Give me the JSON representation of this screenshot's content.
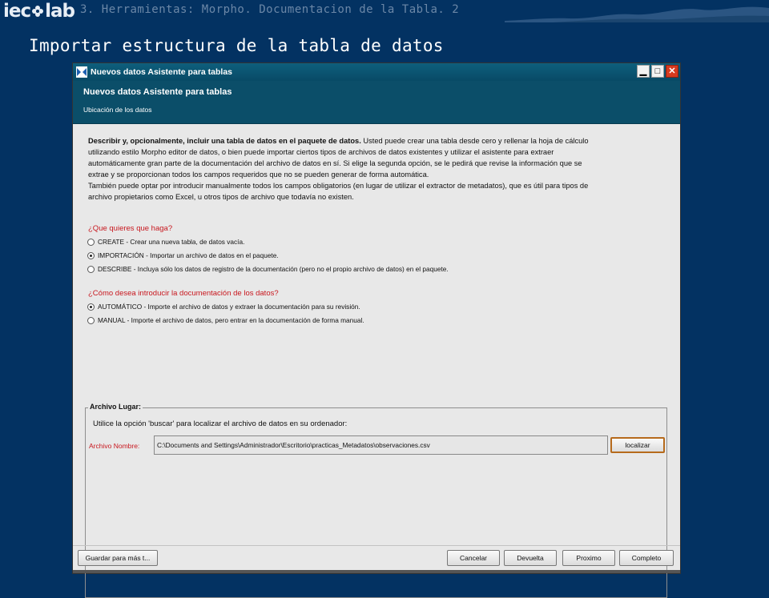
{
  "slide": {
    "logo_text_left": "iec",
    "logo_text_right": "lab",
    "breadcrumb": "3. Herramientas: Morpho. Documentacion de la Tabla. 2",
    "title": "Importar estructura de la tabla de datos"
  },
  "window": {
    "title": "Nuevos datos Asistente para tablas",
    "header_title": "Nuevos datos Asistente para tablas",
    "header_subtitle": "Ubicación de los datos",
    "minimize_glyph": "▁",
    "maximize_glyph": "□",
    "close_glyph": "✕"
  },
  "intro": {
    "bold": "Describir y, opcionalmente, incluir una tabla de datos en el paquete de datos.",
    "text1": " Usted puede crear una tabla desde cero y rellenar la hoja de cálculo utilizando estilo Morpho editor de datos, o bien puede importar ciertos tipos de archivos de datos existentes y utilizar el asistente para extraer automáticamente gran parte de la documentación del archivo de datos en sí. Si elige la segunda opción, se le pedirá que revise la información que se extrae y se proporcionan todos los campos requeridos que no se pueden generar de forma automática.",
    "text2": "También puede optar por introducir manualmente todos los campos obligatorios (en lugar de utilizar el extractor de metadatos), que es útil para tipos de archivo propietarios como Excel, u otros tipos de archivo que todavía no existen."
  },
  "question1": {
    "label": "¿Que quieres que haga?",
    "options": [
      {
        "text": "CREATE - Crear una nueva tabla, de datos vacía.",
        "selected": false
      },
      {
        "text": "IMPORTACIÓN - Importar un archivo de datos en el paquete.",
        "selected": true
      },
      {
        "text": "DESCRIBE - Incluya sólo los datos de registro de la documentación (pero no el propio archivo de datos) en el paquete.",
        "selected": false
      }
    ]
  },
  "question2": {
    "label": "¿Cómo desea introducir la documentación de los datos?",
    "options": [
      {
        "text": "AUTOMÁTICO - Importe el archivo de datos y extraer la documentación para su revisión.",
        "selected": true
      },
      {
        "text": "MANUAL - Importe el archivo de datos, pero entrar en la documentación de forma manual.",
        "selected": false
      }
    ]
  },
  "file_section": {
    "legend": "Archivo Lugar:",
    "hint": "Utilice la opción 'buscar' para localizar el archivo de datos en su ordenador:",
    "label": "Archivo Nombre:",
    "value": "C:\\Documents and Settings\\Administrador\\Escritorio\\practicas_Metadatos\\observaciones.csv",
    "browse_label": "localizar"
  },
  "footer": {
    "save_label": "Guardar para más t...",
    "cancel_label": "Cancelar",
    "back_label": "Devuelta",
    "next_label": "Proximo",
    "finish_label": "Completo"
  },
  "colors": {
    "slide_bg": "#033262",
    "header_band": "#0b4e69",
    "question_red": "#c8171e"
  }
}
